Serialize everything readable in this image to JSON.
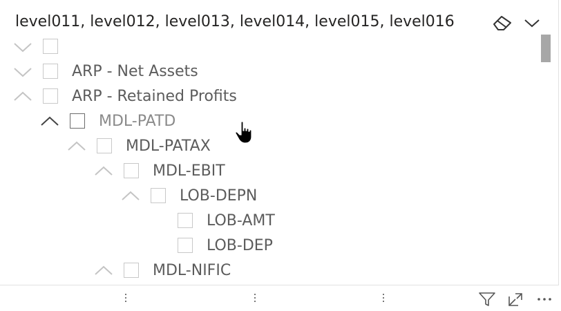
{
  "slicer": {
    "header_title": "level011, level012, level013, level014, level015, level016",
    "header_icons": [
      "eraser-icon",
      "chevron-down-icon"
    ],
    "rows": [
      {
        "label": "",
        "chevron": "down",
        "level": 0,
        "dark": false
      },
      {
        "label": "ARP - Net Assets",
        "chevron": "down",
        "level": 0,
        "dark": false
      },
      {
        "label": "ARP - Retained Profits",
        "chevron": "up",
        "level": 0,
        "dark": false
      },
      {
        "label": "MDL-PATD",
        "chevron": "up",
        "level": 1,
        "dark": true
      },
      {
        "label": "MDL-PATAX",
        "chevron": "up",
        "level": 2,
        "dark": false
      },
      {
        "label": "MDL-EBIT",
        "chevron": "up",
        "level": 3,
        "dark": false
      },
      {
        "label": "LOB-DEPN",
        "chevron": "up",
        "level": 4,
        "dark": false
      },
      {
        "label": "LOB-AMT",
        "chevron": "none",
        "level": 5,
        "dark": false
      },
      {
        "label": "LOB-DEP",
        "chevron": "none",
        "level": 5,
        "dark": false
      },
      {
        "label": "MDL-NIFIC",
        "chevron": "up",
        "level": 3,
        "dark": false
      }
    ]
  },
  "footer": {
    "icons": [
      "filter-icon",
      "focus-mode-icon",
      "more-options-icon"
    ]
  },
  "colors": {
    "text": "#252423",
    "item_text": "#5c5c5c",
    "checkbox_border": "#c8c8c8",
    "scrollbar": "#a7a7a7"
  }
}
